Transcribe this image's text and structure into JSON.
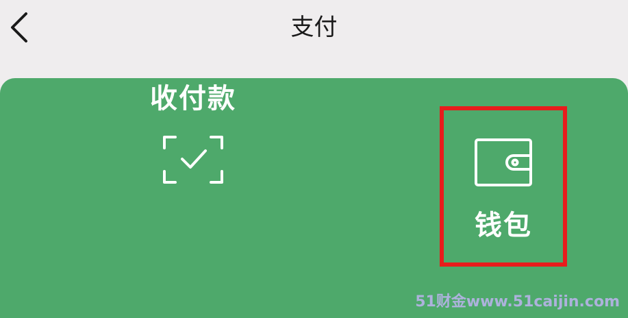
{
  "header": {
    "title": "支付",
    "back_icon": "chevron-left-icon"
  },
  "pay_panel": {
    "background": "#4ea96b",
    "actions": [
      {
        "label": "收付款",
        "icon": "scan-check-icon"
      },
      {
        "label": "钱包",
        "icon": "wallet-icon",
        "highlight_color": "#e81c1c"
      }
    ]
  },
  "watermark": "51财金www.51caijin.com"
}
